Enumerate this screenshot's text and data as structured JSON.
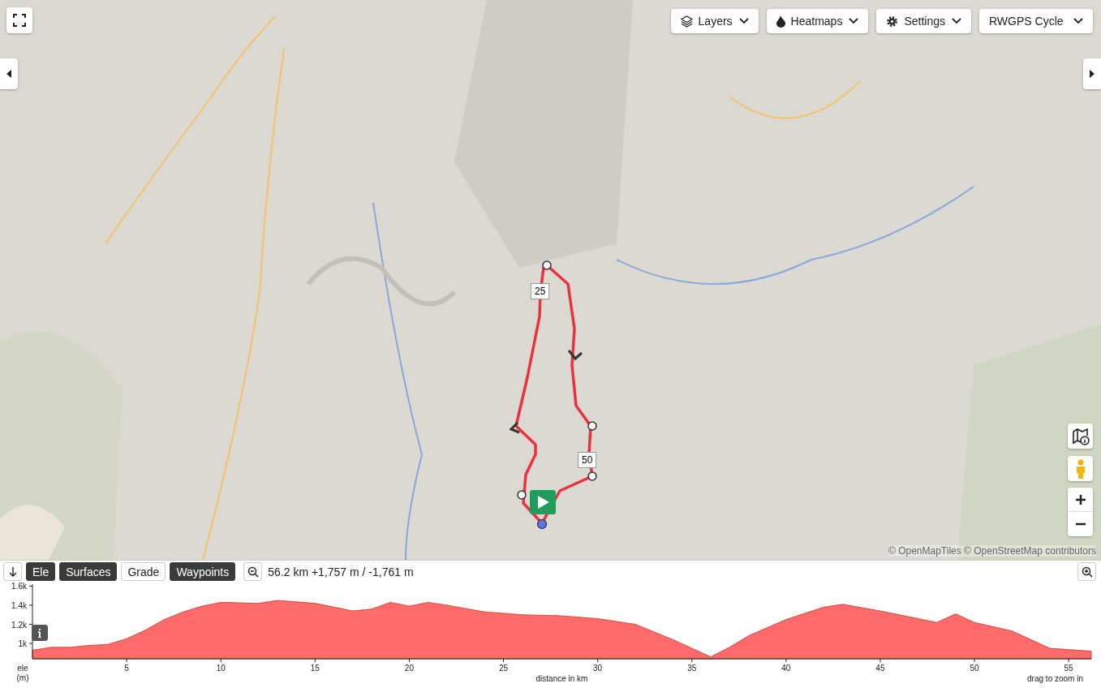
{
  "map": {
    "controls": [
      "Layers",
      "Heatmaps",
      "Settings"
    ],
    "basemap": "RWGPS Cycle",
    "distance_markers": [
      "25",
      "50"
    ],
    "attribution": "© OpenMapTiles © OpenStreetMap contributors"
  },
  "elevation": {
    "toggles": [
      {
        "label": "Ele",
        "selected": true
      },
      {
        "label": "Surfaces",
        "selected": true
      },
      {
        "label": "Grade",
        "selected": false
      },
      {
        "label": "Waypoints",
        "selected": true
      }
    ],
    "summary": "56.2 km +1,757 m / -1,761 m",
    "hint": "drag to zoom in",
    "chart_data": {
      "type": "area",
      "xlabel": "distance in km",
      "ylabel": "ele (m)",
      "x": [
        0,
        1,
        2,
        3,
        4,
        5,
        6,
        7,
        8,
        9,
        10,
        12,
        13,
        15,
        17,
        18,
        19,
        20,
        21,
        22,
        24,
        26,
        28,
        30,
        32,
        34,
        36,
        37,
        38,
        40,
        42,
        43,
        45,
        46,
        48,
        49,
        50,
        52,
        54,
        56.2
      ],
      "series": [
        {
          "color": "#ff6b6b",
          "values": [
            930,
            960,
            960,
            980,
            990,
            1050,
            1140,
            1250,
            1330,
            1390,
            1430,
            1420,
            1450,
            1420,
            1340,
            1360,
            1430,
            1390,
            1430,
            1400,
            1330,
            1300,
            1290,
            1260,
            1200,
            1040,
            860,
            960,
            1080,
            1250,
            1380,
            1410,
            1340,
            1300,
            1220,
            1310,
            1220,
            1130,
            950,
            920
          ]
        }
      ],
      "xlim": [
        0,
        56.2
      ],
      "ylim": [
        840,
        1620
      ],
      "xticks": [
        5,
        10,
        15,
        20,
        25,
        30,
        35,
        40,
        45,
        50,
        55
      ],
      "yticks": [
        {
          "value": 1000,
          "label": "1k"
        },
        {
          "value": 1200,
          "label": "1.2k"
        },
        {
          "value": 1400,
          "label": "1.4k"
        },
        {
          "value": 1600,
          "label": "1.6k"
        }
      ]
    }
  }
}
